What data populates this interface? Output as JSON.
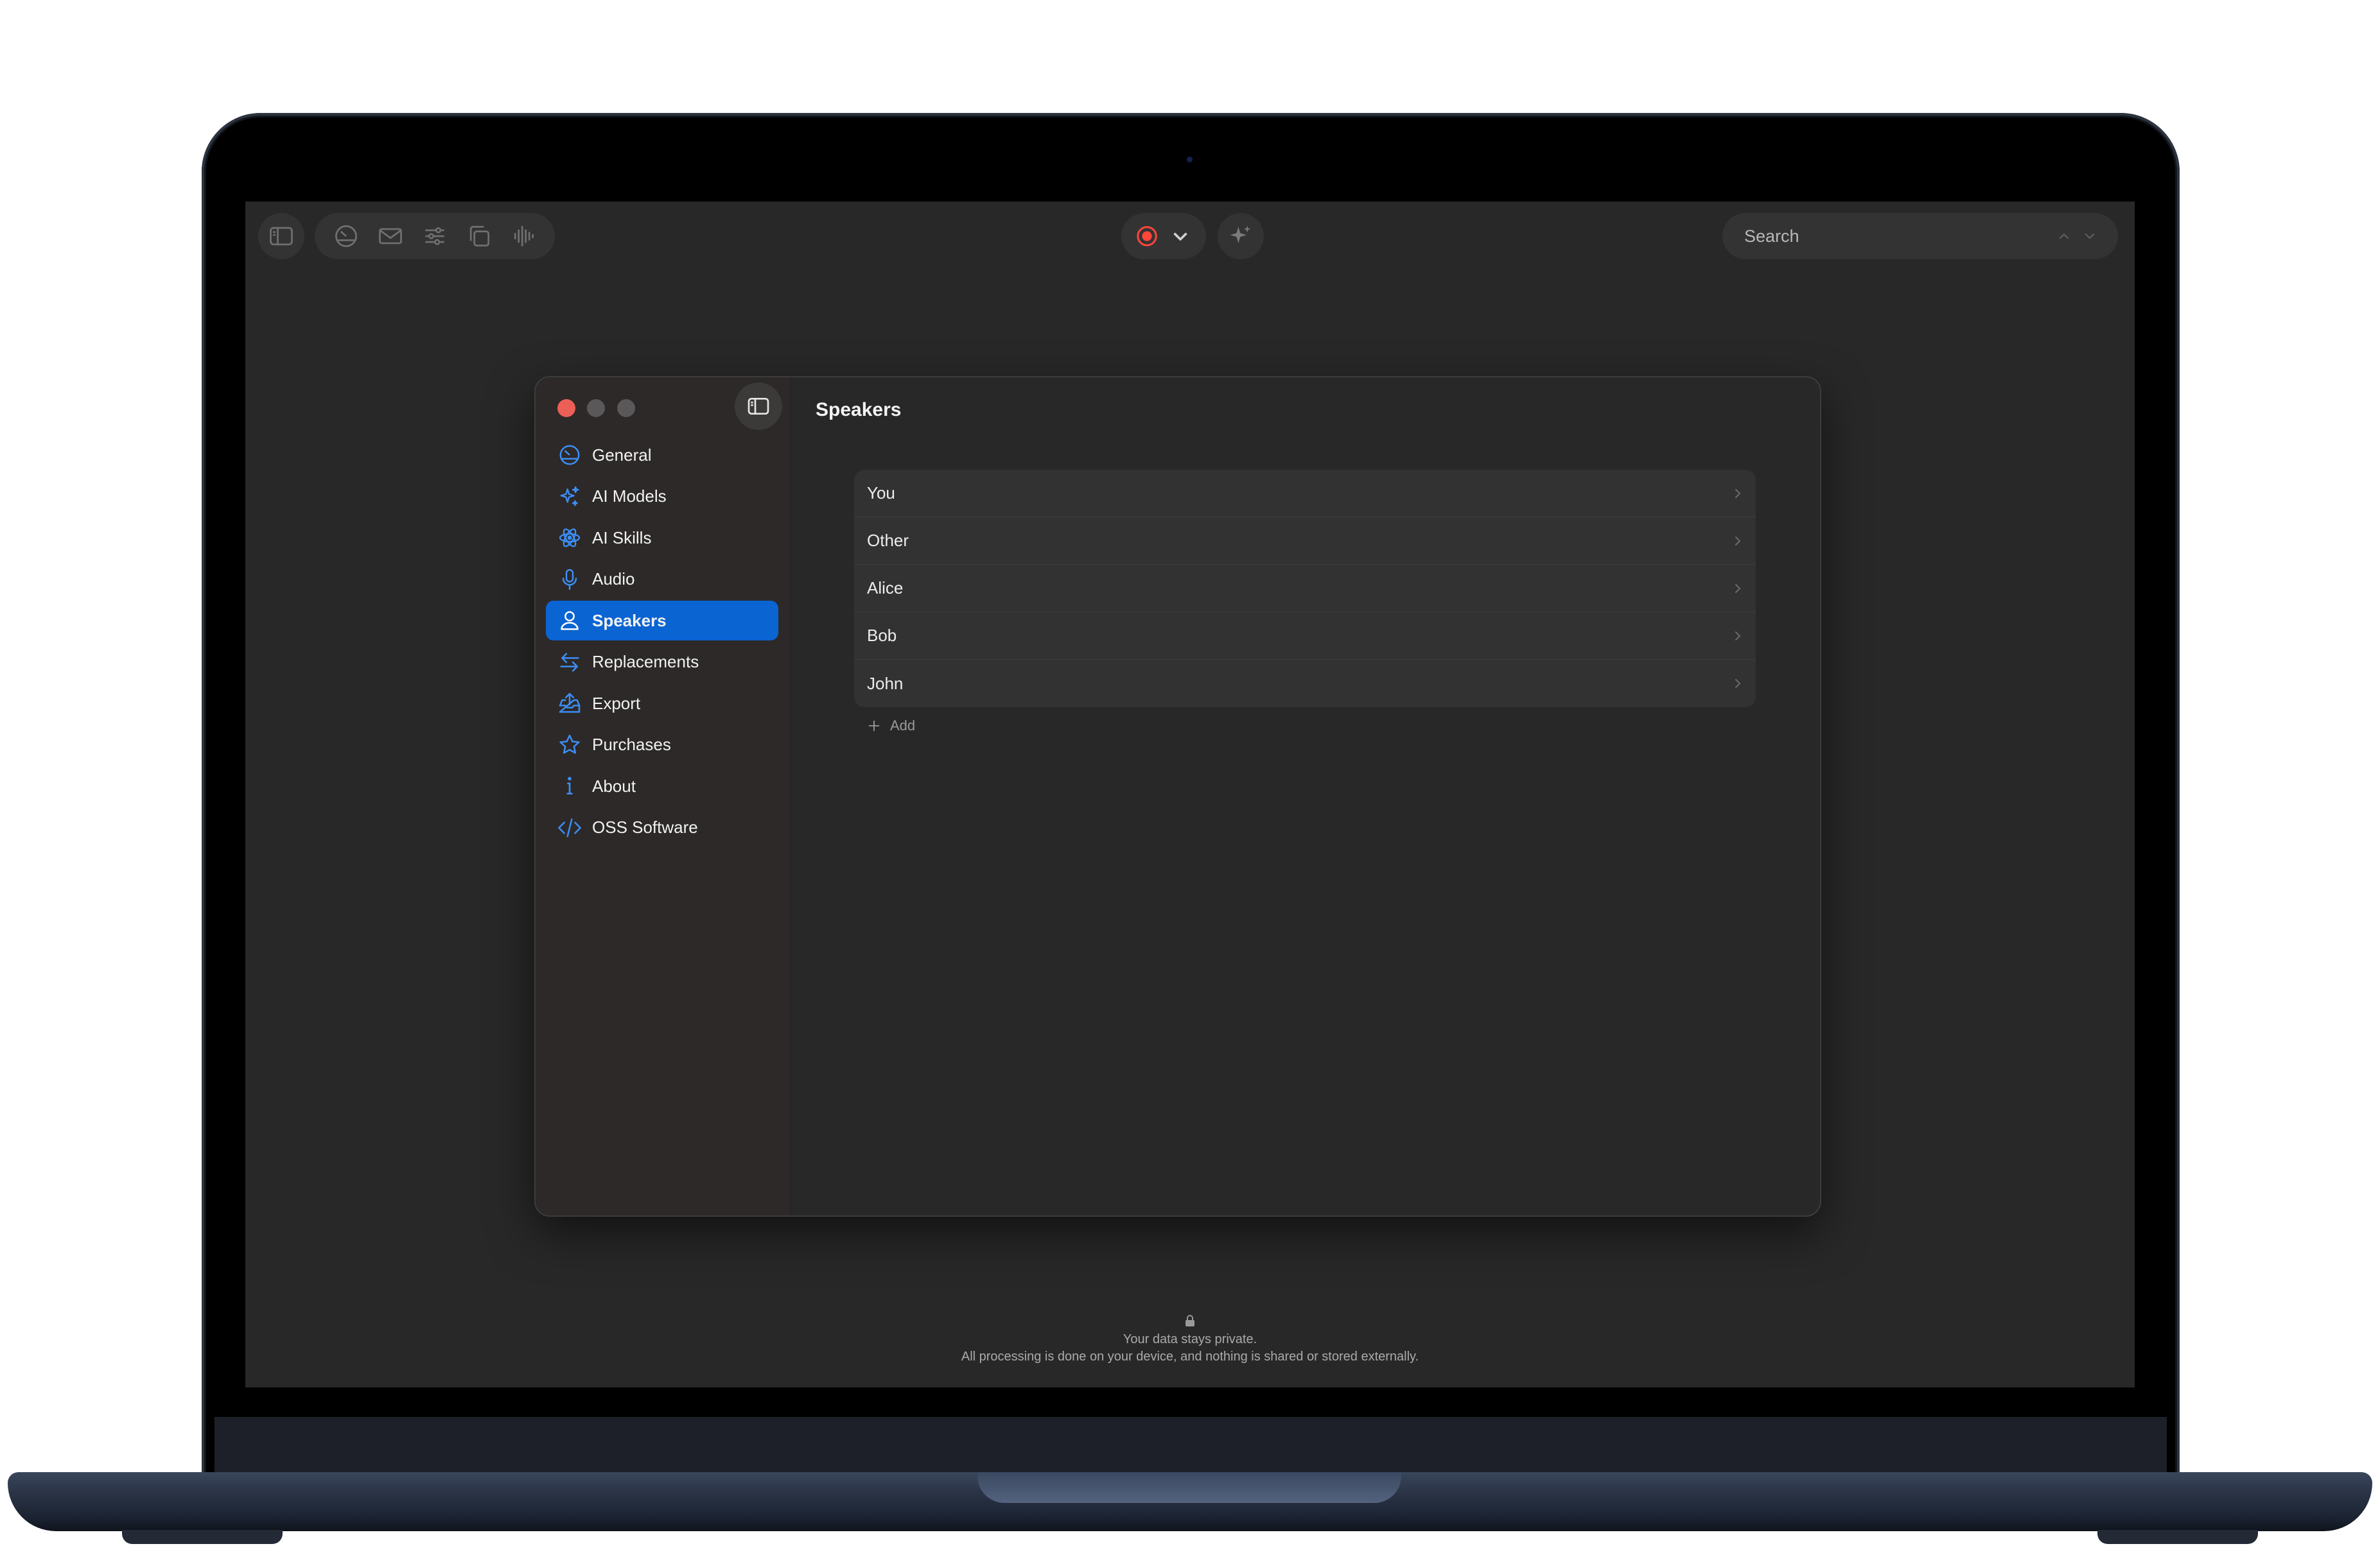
{
  "toolbar": {
    "search": {
      "placeholder": "Search"
    }
  },
  "window": {
    "title": "Speakers",
    "sidebar": {
      "items": [
        {
          "label": "General",
          "icon": "gauge-icon"
        },
        {
          "label": "AI Models",
          "icon": "sparkles-icon"
        },
        {
          "label": "AI Skills",
          "icon": "atom-icon"
        },
        {
          "label": "Audio",
          "icon": "microphone-icon"
        },
        {
          "label": "Speakers",
          "icon": "person-icon",
          "selected": true
        },
        {
          "label": "Replacements",
          "icon": "swap-arrows-icon"
        },
        {
          "label": "Export",
          "icon": "tray-upload-icon"
        },
        {
          "label": "Purchases",
          "icon": "star-icon"
        },
        {
          "label": "About",
          "icon": "info-icon"
        },
        {
          "label": "OSS Software",
          "icon": "code-brackets-icon"
        }
      ]
    },
    "speakers": [
      "You",
      "Other",
      "Alice",
      "Bob",
      "John"
    ],
    "add_label": "Add"
  },
  "privacy": {
    "line1": "Your data stays private.",
    "line2": "All processing is done on your device, and nothing is shared or stored externally."
  },
  "colors": {
    "accent": "#0a64d2",
    "icon_blue": "#3d8ef5",
    "record_red": "#ff453a",
    "close_red": "#ec5f57",
    "screen_bg": "#282828"
  }
}
